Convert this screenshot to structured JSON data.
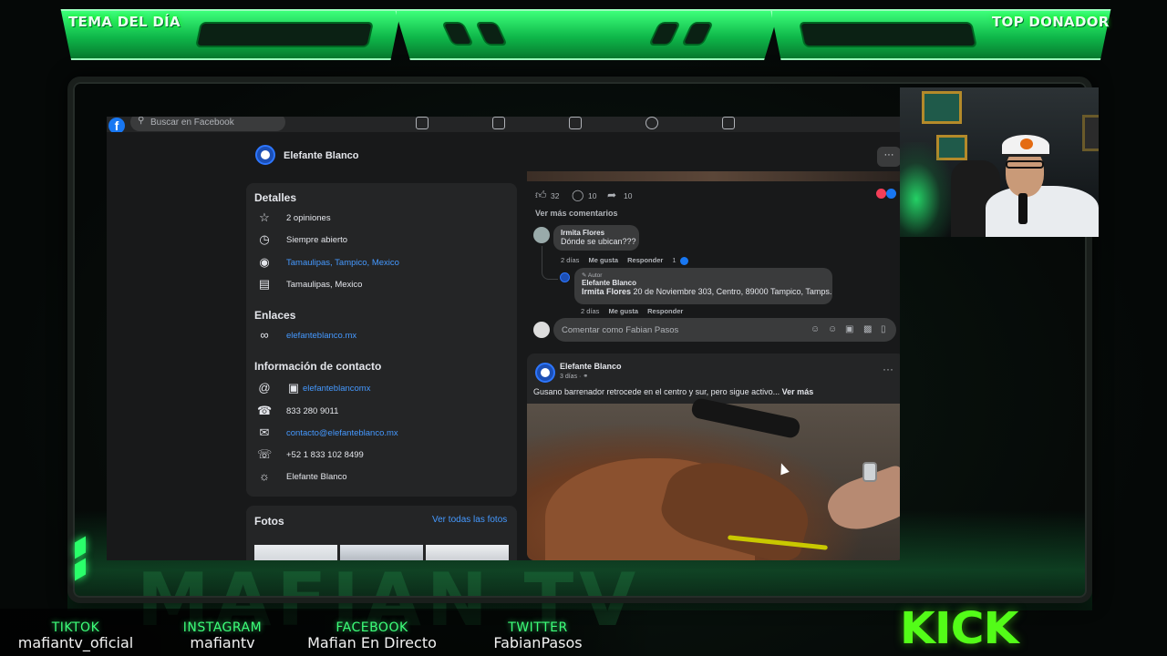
{
  "overlay": {
    "left_label": "TEMA DEL DÍA",
    "right_label": "TOP DONADOR",
    "kick_logo": "KICK",
    "socials": [
      {
        "network": "TIKTOK",
        "handle": "mafiantv_oficial"
      },
      {
        "network": "INSTAGRAM",
        "handle": "mafiantv"
      },
      {
        "network": "FACEBOOK",
        "handle": "Mafian En Directo"
      },
      {
        "network": "TWITTER",
        "handle": "FabianPasos"
      }
    ],
    "accent_color": "#3dff7a"
  },
  "facebook": {
    "search_placeholder": "Buscar en Facebook",
    "page_name": "Elefante Blanco",
    "more_label": "···",
    "details": {
      "title": "Detalles",
      "rows": [
        {
          "icon": "star-icon",
          "text": "2 opiniones"
        },
        {
          "icon": "clock-icon",
          "text": "Siempre abierto"
        },
        {
          "icon": "location-pin-icon",
          "text": "Tamaulipas, Tampico, Mexico"
        },
        {
          "icon": "map-icon",
          "text": "Tamaulipas, Mexico"
        }
      ]
    },
    "links": {
      "title": "Enlaces",
      "website": "elefanteblanco.mx"
    },
    "contact": {
      "title": "Información de contacto",
      "instagram": "elefanteblancomx",
      "phone": "833 280 9011",
      "email": "contacto@elefanteblanco.mx",
      "whatsapp": "+52 1 833 102 8499",
      "messenger": "Elefante Blanco"
    },
    "photos": {
      "title": "Fotos",
      "see_all": "Ver todas las fotos"
    },
    "post1": {
      "likes": "32",
      "comments": "10",
      "shares": "10",
      "more_comments": "Ver más comentarios",
      "comment": {
        "author": "Irmita Flores",
        "text": "Dónde se ubican???",
        "age": "2 días",
        "like": "Me gusta",
        "reply": "Responder",
        "like_count": "1"
      },
      "reply": {
        "badge": "Autor",
        "author": "Elefante Blanco",
        "mention": "Irmita Flores",
        "text": "20 de Noviembre 303, Centro, 89000 Tampico, Tamps.",
        "age": "2 días",
        "like": "Me gusta",
        "reply": "Responder"
      },
      "comment_input": "Comentar como Fabian Pasos"
    },
    "post2": {
      "author": "Elefante Blanco",
      "age": "3 días ·",
      "text": "Gusano barrenador retrocede en el centro y sur, pero sigue activo...",
      "see_more": "Ver más"
    }
  }
}
